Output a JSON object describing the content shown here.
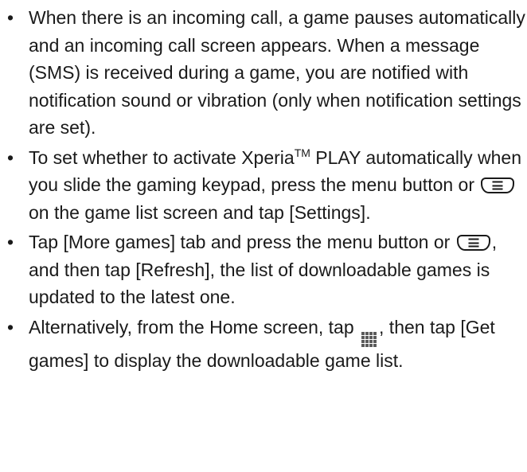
{
  "bullets": [
    {
      "text": "When there is an incoming call, a game pauses automatically and an incoming call screen appears. When a message (SMS) is received during a game, you are notified with notification sound or vibration (only when notification settings are set)."
    },
    {
      "part1": "To set whether to activate Xperia",
      "superscript": "TM",
      "part2": " PLAY automatically when you slide the gaming keypad, press the menu button or ",
      "part3": " on the game list screen and tap [Settings]."
    },
    {
      "part1": "Tap [More games] tab and press the menu button or ",
      "part2": ", and then tap [Refresh], the list of downloadable games is updated to the latest one."
    },
    {
      "part1": "Alternatively, from the Home screen, tap ",
      "part2": ", then tap [Get games] to display the downloadable game list."
    }
  ],
  "bullet_symbol": "•",
  "icons": {
    "menu_key": "menu-key-icon",
    "apps_grid": "apps-grid-icon"
  }
}
